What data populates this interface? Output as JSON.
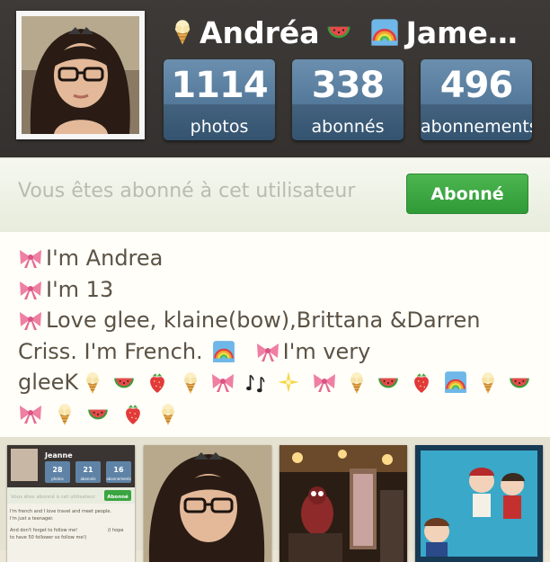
{
  "profile": {
    "username_part1": "Andréa",
    "username_part2": "Jame…",
    "stats": [
      {
        "count": "1114",
        "label": "photos"
      },
      {
        "count": "338",
        "label": "abonnés"
      },
      {
        "count": "496",
        "label": "abonnements"
      }
    ]
  },
  "follow": {
    "status_text": "Vous êtes abonné à cet utilisateur",
    "button_label": "Abonné",
    "button_color": "#3aa540"
  },
  "bio": {
    "line1": "I'm Andrea",
    "line2": "I'm 13",
    "line3": "Love glee, klaine(bow),Brittana &Darren",
    "line4a": "Criss. I'm French.",
    "line4b": "I'm very",
    "line5": "gleeK"
  },
  "thumbnail_1": {
    "name": "Jeanne",
    "stats": [
      {
        "count": "28",
        "label": "photos"
      },
      {
        "count": "21",
        "label": "abonnés"
      },
      {
        "count": "16",
        "label": "abonnements"
      }
    ],
    "follow_text": "Vous êtes abonné à cet utilisateur",
    "button_label": "Abonné",
    "bio_line1": "I'm french and I love travel and meet people.",
    "bio_line2": "I'm just a teenager.",
    "bio_line3": "And don't forget to follow me!",
    "bio_line4": "(I hope",
    "bio_line5": "to have 50 follower so follow me!)"
  },
  "icons": [
    "ice-cream-icon",
    "watermelon-icon",
    "rainbow-icon",
    "ribbon-icon",
    "strawberry-icon",
    "music-notes-icon",
    "sparkle-icon"
  ],
  "colors": {
    "stat_blue": "#4f7598",
    "header": "#383532",
    "bio_text": "#5b5244"
  }
}
